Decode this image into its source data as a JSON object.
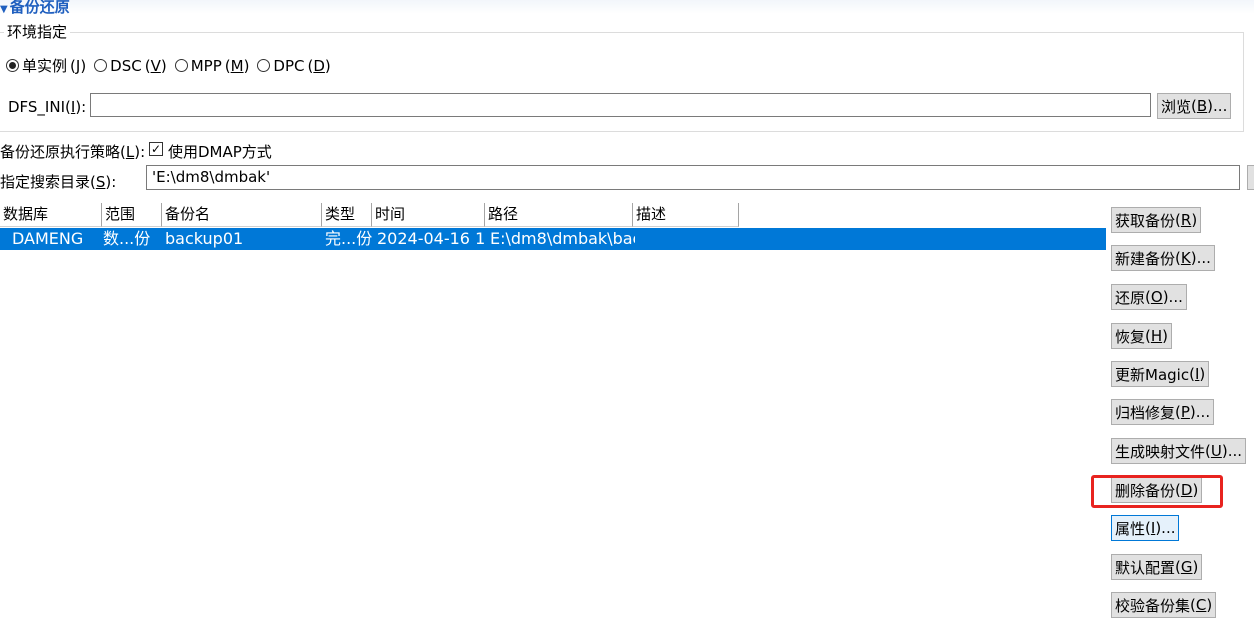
{
  "section": {
    "title": "备份还原"
  },
  "env_group": {
    "legend": "环境指定",
    "radios": [
      {
        "label": "单实例",
        "key": "J",
        "checked": true
      },
      {
        "label": "DSC",
        "key": "V",
        "checked": false
      },
      {
        "label": "MPP",
        "key": "M",
        "checked": false
      },
      {
        "label": "DPC",
        "key": "D",
        "checked": false
      }
    ],
    "dfs_label": "DFS_INI",
    "dfs_key": "I",
    "dfs_value": "",
    "browse_label": "浏览",
    "browse_key": "B",
    "browse_suffix": "..."
  },
  "strategy": {
    "label": "备份还原执行策略",
    "key": "L",
    "checkbox_label": "使用DMAP方式",
    "checked": true
  },
  "search_dir": {
    "label": "指定搜索目录",
    "key": "S",
    "value": "'E:\\dm8\\dmbak'"
  },
  "table": {
    "columns": [
      "数据库",
      "范围",
      "备份名",
      "类型",
      "时间",
      "路径",
      "描述"
    ],
    "rows": [
      {
        "db": "DAMENG",
        "range": "数...份",
        "name": "backup01",
        "type": "完...份",
        "time": "2024-04-16 1:",
        "path": "E:\\dm8\\dmbak\\bac",
        "desc": "",
        "selected": true
      }
    ]
  },
  "side_buttons": [
    {
      "label": "获取备份",
      "key": "R",
      "suffix": ""
    },
    {
      "label": "新建备份",
      "key": "K",
      "suffix": "..."
    },
    {
      "label": "还原",
      "key": "O",
      "suffix": "..."
    },
    {
      "label": "恢复",
      "key": "H",
      "suffix": ""
    },
    {
      "label": "更新Magic",
      "key": "I",
      "suffix": ""
    },
    {
      "label": "归档修复",
      "key": "P",
      "suffix": "..."
    },
    {
      "label": "生成映射文件",
      "key": "U",
      "suffix": "..."
    },
    {
      "label": "删除备份",
      "key": "D",
      "suffix": "",
      "highlighted": true
    },
    {
      "label": "属性",
      "key": "I",
      "suffix": "...",
      "focused": true
    },
    {
      "label": "默认配置",
      "key": "G",
      "suffix": ""
    },
    {
      "label": "校验备份集",
      "key": "C",
      "suffix": ""
    }
  ],
  "colors": {
    "selection": "#0078d7",
    "highlight": "#e8231f",
    "title": "#1f5fbf"
  }
}
